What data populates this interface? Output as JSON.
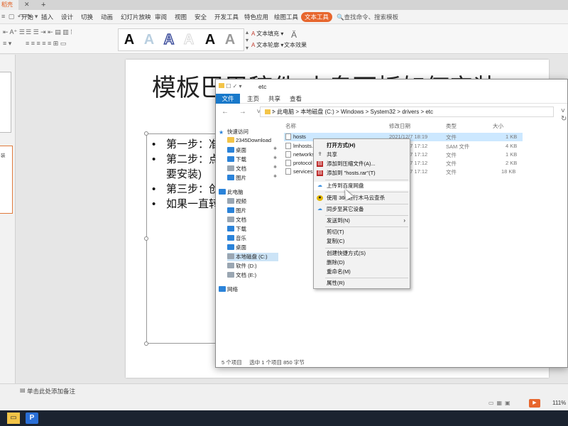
{
  "app": {
    "tab_label": "稻壳",
    "add_tab": "+"
  },
  "menubar": {
    "items": [
      "开始",
      "插入",
      "设计",
      "切换",
      "动画",
      "幻灯片放映",
      "审阅",
      "视图",
      "安全",
      "开发工具",
      "特色应用",
      "绘图工具"
    ],
    "active": "文本工具",
    "search": "查找命令、搜索模板"
  },
  "toolbar": {
    "wordart_glyph": "A",
    "text_fill": "文本填充",
    "text_outline": "文本轮廓",
    "text_effect": "文本效果"
  },
  "slide": {
    "title": "模板巴巴稿件 小鬼面板如何安装",
    "bullets": [
      "第一步：准",
      "第二步：点",
      "要安装)",
      "第三步：创",
      "如果一直转"
    ]
  },
  "notes": {
    "placeholder": "单击此处添加备注"
  },
  "status": {
    "zoom": "111%"
  },
  "explorer": {
    "title": "etc",
    "qat": "☐ ✓ ▾",
    "tabs": [
      "文件",
      "主页",
      "共享",
      "查看"
    ],
    "path": [
      "此电脑",
      "本地磁盘 (C:)",
      "Windows",
      "System32",
      "drivers",
      "etc"
    ],
    "nav": [
      {
        "label": "快速访问",
        "icon": "star-icon"
      },
      {
        "label": "2345Download",
        "icon": "folder-icon"
      },
      {
        "label": "桌面",
        "icon": "desktop-icon"
      },
      {
        "label": "下载",
        "icon": "download-icon"
      },
      {
        "label": "文档",
        "icon": "document-icon"
      },
      {
        "label": "图片",
        "icon": "picture-icon"
      },
      {
        "label": "此电脑",
        "icon": "computer-icon"
      },
      {
        "label": "视频",
        "icon": "video-icon"
      },
      {
        "label": "图片",
        "icon": "picture-icon"
      },
      {
        "label": "文档",
        "icon": "document-icon"
      },
      {
        "label": "下载",
        "icon": "download-icon"
      },
      {
        "label": "音乐",
        "icon": "music-icon"
      },
      {
        "label": "桌面",
        "icon": "desktop-icon"
      },
      {
        "label": "本地磁盘 (C:)",
        "icon": "drive-icon"
      },
      {
        "label": "软件 (D:)",
        "icon": "drive-icon"
      },
      {
        "label": "文档 (E:)",
        "icon": "drive-icon"
      },
      {
        "label": "网络",
        "icon": "network-icon"
      }
    ],
    "columns": {
      "name": "名称",
      "date": "修改日期",
      "type": "类型",
      "size": "大小"
    },
    "files": [
      {
        "name": "hosts",
        "date": "2021/12/7 18:19",
        "type": "文件",
        "size": "1 KB"
      },
      {
        "name": "lmhosts.sam",
        "date": "2019/12/7 17:12",
        "type": "SAM 文件",
        "size": "4 KB"
      },
      {
        "name": "networks",
        "date": "2019/12/7 17:12",
        "type": "文件",
        "size": "1 KB"
      },
      {
        "name": "protocol",
        "date": "2019/12/7 17:12",
        "type": "文件",
        "size": "2 KB"
      },
      {
        "name": "services",
        "date": "2019/12/7 17:12",
        "type": "文件",
        "size": "18 KB"
      }
    ],
    "status_count": "5 个项目",
    "status_selected": "选中 1 个项目  850 字节"
  },
  "context_menu": [
    {
      "label": "打开方式(H)",
      "bold": true
    },
    {
      "label": "共享",
      "icon": "share-icon"
    },
    {
      "label": "添加到压缩文件(A)...",
      "icon": "archive-icon"
    },
    {
      "label": "添加到 \"hosts.rar\"(T)",
      "icon": "archive-icon"
    },
    {
      "label": "上传到百度网盘",
      "icon": "cloud-icon"
    },
    {
      "label": "使用 360进行木马云查杀",
      "icon": "shield-icon"
    },
    {
      "label": "同步至其它设备",
      "icon": "cloud-icon"
    },
    {
      "label": "发送到(N)",
      "submenu": true
    },
    {
      "label": "剪切(T)"
    },
    {
      "label": "复制(C)"
    },
    {
      "label": "创建快捷方式(S)"
    },
    {
      "label": "删除(D)"
    },
    {
      "label": "重命名(M)"
    },
    {
      "label": "属性(R)"
    }
  ]
}
